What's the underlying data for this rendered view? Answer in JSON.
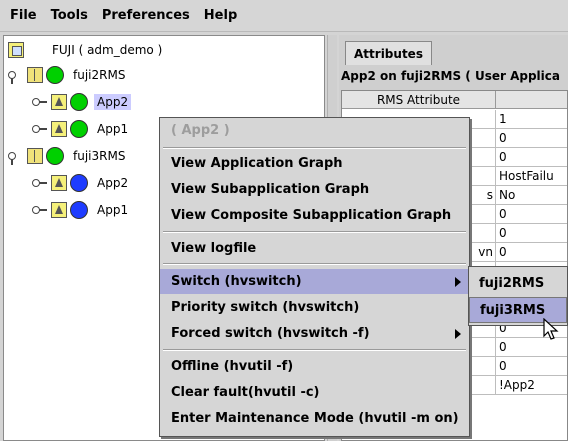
{
  "menubar": {
    "items": [
      "File",
      "Tools",
      "Preferences",
      "Help"
    ]
  },
  "tree": {
    "root": "FUJI ( adm_demo )",
    "nodes": [
      {
        "label": "fuji2RMS",
        "status": "green"
      },
      {
        "label": "App2",
        "status": "green",
        "selected": true
      },
      {
        "label": "App1",
        "status": "green"
      },
      {
        "label": "fuji3RMS",
        "status": "green"
      },
      {
        "label": "App2",
        "status": "blue"
      },
      {
        "label": "App1",
        "status": "blue"
      }
    ]
  },
  "right": {
    "tab": "Attributes",
    "title": "App2 on fuji2RMS ( User Applica",
    "columns": [
      "RMS Attribute",
      ""
    ],
    "rows": [
      {
        "attr": "",
        "value": "1"
      },
      {
        "attr": "",
        "value": "0"
      },
      {
        "attr": "",
        "value": "0"
      },
      {
        "attr": "",
        "value": "HostFailu"
      },
      {
        "attr": "s",
        "value": "No"
      },
      {
        "attr": "",
        "value": "0"
      },
      {
        "attr": "",
        "value": "0"
      },
      {
        "attr": "vn",
        "value": "0"
      },
      {
        "attr": "",
        "value": ""
      },
      {
        "attr": "",
        "value": ""
      },
      {
        "attr": "",
        "value": "fuji2RMS"
      },
      {
        "attr": "",
        "value": "0"
      },
      {
        "attr": "",
        "value": "0"
      },
      {
        "attr": "",
        "value": "0"
      },
      {
        "attr": "",
        "value": "!App2"
      }
    ]
  },
  "context_menu": {
    "header": "( App2 )",
    "items": [
      "View Application Graph",
      "View Subapplication Graph",
      "View Composite Subapplication Graph",
      "View logfile",
      "Switch (hvswitch)",
      "Priority switch (hvswitch)",
      "Forced switch (hvswitch -f)",
      "Offline (hvutil -f)",
      "Clear fault(hvutil -c)",
      "Enter Maintenance Mode (hvutil -m on)"
    ]
  },
  "submenu": {
    "items": [
      "fuji2RMS",
      "fuji3RMS"
    ]
  },
  "colors": {
    "selection": "#ccccff",
    "menu_highlight": "#a8a9d8",
    "online": "#00d000",
    "offline": "#1e3cff"
  }
}
